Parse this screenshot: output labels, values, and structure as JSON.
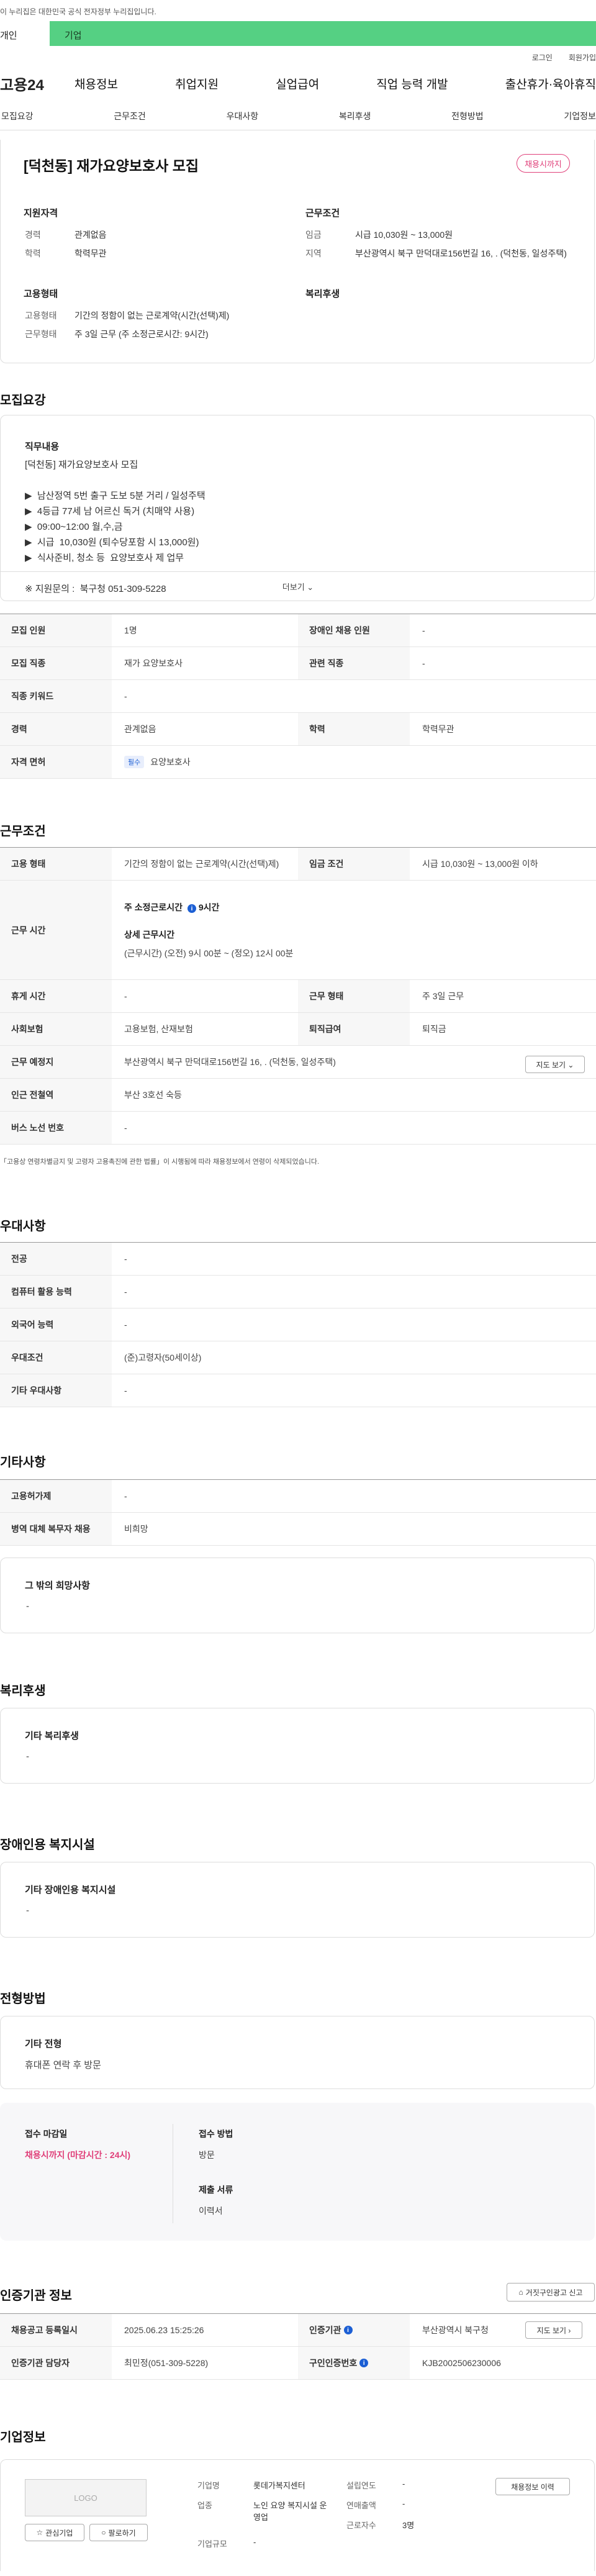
{
  "gov_banner": "이 누리집은 대한민국 공식 전자정부 누리집입니다.",
  "categories": {
    "personal": "개인",
    "company": "기업"
  },
  "util": {
    "login": "로그인",
    "signup": "회원가입"
  },
  "gnb": {
    "logo": "고용24",
    "menus": [
      "채용정보",
      "취업지원",
      "실업급여",
      "직업 능력 개발",
      "출산휴가·육아휴직"
    ]
  },
  "snb": [
    "모집요강",
    "근무조건",
    "우대사항",
    "복리후생",
    "전형방법",
    "기업정보"
  ],
  "header": {
    "title": "[덕천동] 재가요양보호사 모집",
    "badge": "채용시까지",
    "qual_label": "지원자격",
    "cond_label": "근무조건",
    "emp_label": "고용형태",
    "welfare_label": "복리후생",
    "career_k": "경력",
    "career_v": "관계없음",
    "edu_k": "학력",
    "edu_v": "학력무관",
    "wage_k": "임금",
    "wage_v": "시급 10,030원 ~ 13,000원",
    "loc_k": "지역",
    "loc_v": "부산광역시 북구 만덕대로156번길 16, . (덕천동, 일성주택)",
    "emptype_k": "고용형태",
    "emptype_v": "기간의 정함이 없는 근로계약(시간(선택)제)",
    "worktype_k": "근무형태",
    "worktype_v": "주 3일 근무 (주 소정근로시간: 9시간)"
  },
  "recruit": {
    "heading": "모집요강",
    "job_content": "직무내용",
    "desc": "[덕천동] 재가요양보호사 모집\n\n▶  남산정역 5번 출구 도보 5분 거리 / 일성주택\n▶  4등급 77세 남 어르신 독거 (치매약 사용)\n▶  09:00~12:00 월,수,금\n▶  시급  10,030원 (퇴수당포함 시 13,000원)\n▶  식사준비, 청소 등  요양보호사 제 업무\n\n※ 지원문의 :  북구청 051-309-5228",
    "more": "더보기 ⌄",
    "rows": [
      [
        "모집 인원",
        "1명",
        "장애인 채용 인원",
        "-"
      ],
      [
        "모집 직종",
        "재가 요양보호사",
        "관련 직종",
        "-"
      ],
      [
        "직종 키워드",
        "-",
        "",
        ""
      ],
      [
        "경력",
        "관계없음",
        "학력",
        "학력무관"
      ]
    ],
    "license_k": "자격 면허",
    "license_tag": "필수",
    "license_v": "요양보호사"
  },
  "conditions": {
    "heading": "근무조건",
    "emp_k": "고용 형태",
    "emp_v": "기간의 정함이 없는 근로계약(시간(선택)제)",
    "wage_k": "임금 조건",
    "wage_v": "시급 10,030원 ~ 13,000원 이하",
    "time_k": "근무 시간",
    "time_week": "주 소정근로시간",
    "time_week_v": "9시간",
    "time_detail": "상세 근무시간",
    "time_detail_v": "(근무시간) (오전) 9시 00분 ~ (정오) 12시 00분",
    "rest_k": "휴게 시간",
    "rest_v": "-",
    "form_k": "근무 형태",
    "form_v": "주 3일 근무",
    "ins_k": "사회보험",
    "ins_v": "고용보험, 산재보험",
    "sev_k": "퇴직급여",
    "sev_v": "퇴직금",
    "place_k": "근무 예정지",
    "place_v": "부산광역시 북구 만덕대로156번길 16, . (덕천동, 일성주택)",
    "map_btn": "지도 보기 ⌄",
    "subway_k": "인근 전철역",
    "subway_v": "부산 3호선 숙등",
    "bus_k": "버스 노선 번호",
    "bus_v": "-",
    "note": "「고용상 연령차별금지 및 고령자 고용촉진에 관한 법률」이 시행됨에 따라 채용정보에서 연령이 삭제되었습니다."
  },
  "pref": {
    "heading": "우대사항",
    "rows": [
      [
        "전공",
        "-"
      ],
      [
        "컴퓨터 활용 능력",
        "-"
      ],
      [
        "외국어 능력",
        "-"
      ],
      [
        "우대조건",
        "(준)고령자(50세이상)"
      ],
      [
        "기타 우대사항",
        "-"
      ]
    ]
  },
  "etc": {
    "heading": "기타사항",
    "rows": [
      [
        "고용허가제",
        "-"
      ],
      [
        "병역 대체 복무자 채용",
        "비희망"
      ]
    ],
    "hope": "그 밖의 희망사항",
    "hope_v": "-"
  },
  "welfare": {
    "heading": "복리후생",
    "sub": "기타 복리후생",
    "v": "-"
  },
  "disab": {
    "heading": "장애인용 복지시설",
    "sub": "기타 장애인용 복지시설",
    "v": "-"
  },
  "screen": {
    "heading": "전형방법",
    "sub": "기타 전형",
    "v": "휴대폰 연락 후 방문",
    "deadline_k": "접수 마감일",
    "deadline_v": "채용시까지 (마감시간 : 24시)",
    "method_k": "접수 방법",
    "method_v": "방문",
    "docs_k": "제출 서류",
    "docs_v": "이력서"
  },
  "cert": {
    "heading": "인증기관 정보",
    "report_btn": "거짓구인광고 신고",
    "reg_k": "채용공고 등록일시",
    "reg_v": "2025.06.23 15:25:26",
    "org_k": "인증기관",
    "org_v": "부산광역시 북구청",
    "map_btn": "지도 보기 ›",
    "mgr_k": "인증기관 담당자",
    "mgr_v": "최민정(051-309-5228)",
    "no_k": "구인인증번호",
    "no_v": "KJB2002506230006"
  },
  "company": {
    "heading": "기업정보",
    "logo": "LOGO",
    "fav": "관심기업",
    "follow": "팔로하기",
    "name_k": "기업명",
    "name_v": "롯데가복지센터",
    "ind_k": "업종",
    "ind_v": "노인 요양 복지시설 운영업",
    "size_k": "기업규모",
    "size_v": "-",
    "year_k": "설립연도",
    "year_v": "-",
    "sales_k": "연매출액",
    "sales_v": "-",
    "emp_k": "근로자수",
    "emp_v": "3명",
    "info_btn": "채용정보 이력"
  },
  "colors": {
    "accent": "#55d083",
    "badge": "#e0407a",
    "deadline": "#e0407a",
    "info": "#1c5fd4"
  }
}
